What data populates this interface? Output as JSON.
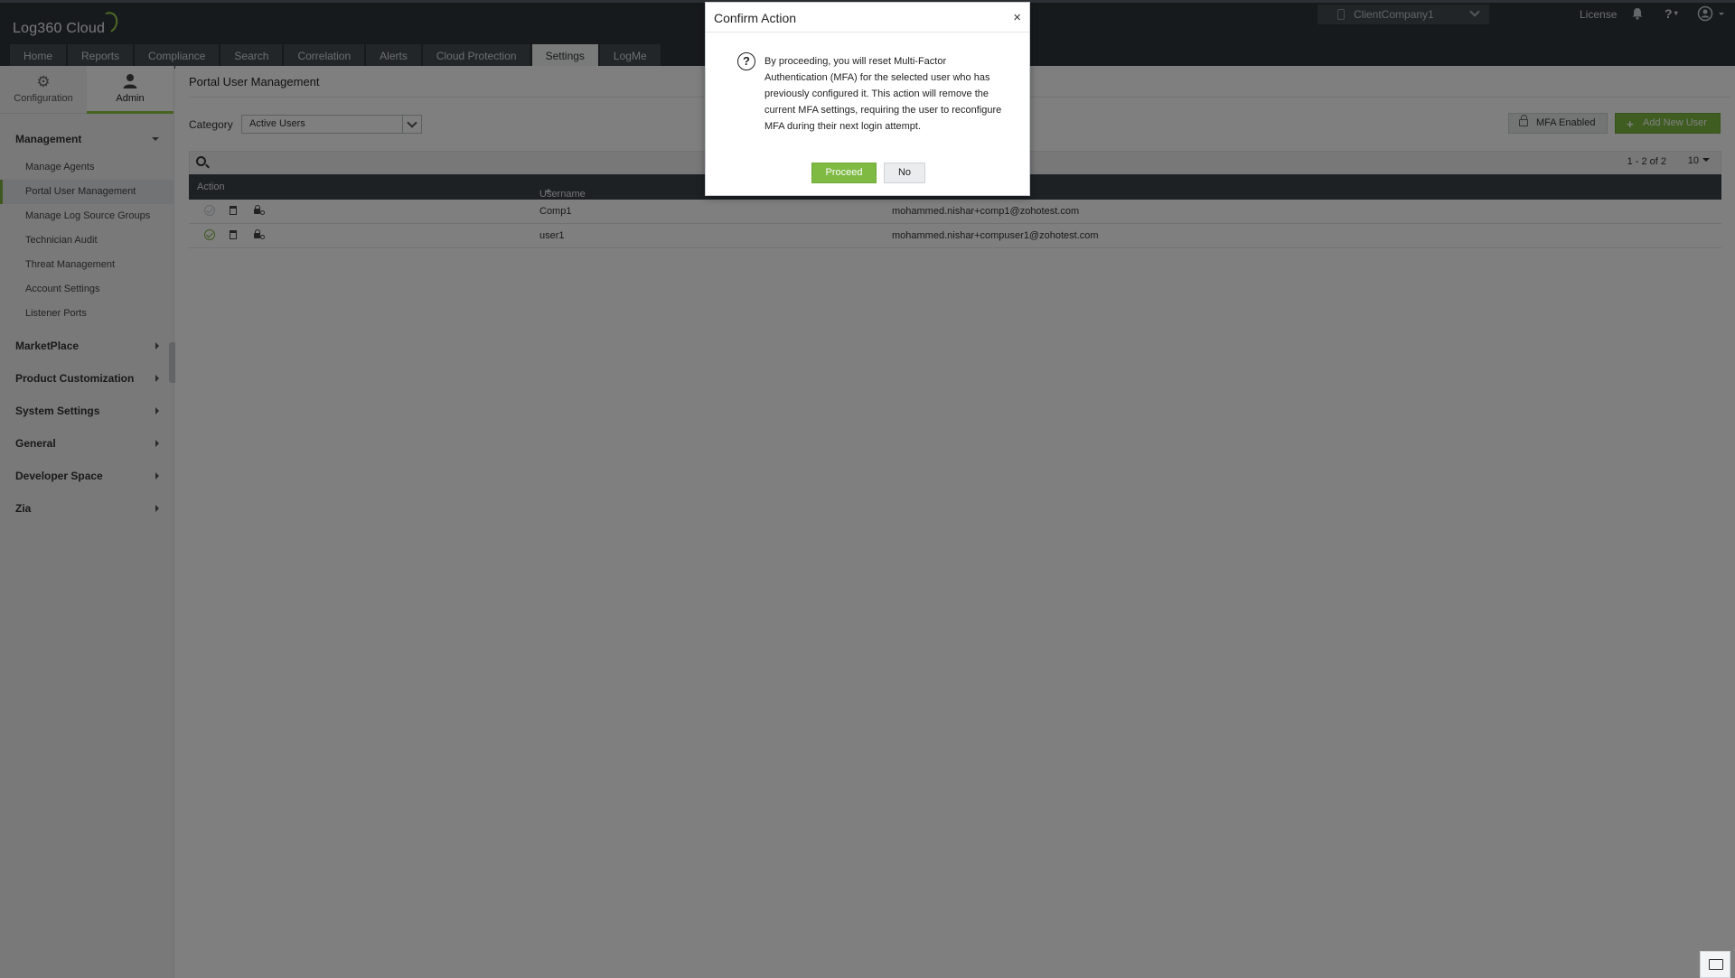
{
  "app": {
    "logo_text": "Log360 Cloud"
  },
  "header": {
    "tabs": [
      {
        "label": "Home"
      },
      {
        "label": "Reports"
      },
      {
        "label": "Compliance"
      },
      {
        "label": "Search"
      },
      {
        "label": "Correlation"
      },
      {
        "label": "Alerts"
      },
      {
        "label": "Cloud Protection"
      },
      {
        "label": "Settings"
      },
      {
        "label": "LogMe"
      }
    ],
    "active_tab": "Settings",
    "client_select": "ClientCompany1",
    "license_link": "License",
    "help_label": "?"
  },
  "sidebar": {
    "switch": {
      "config_label": "Configuration",
      "admin_label": "Admin",
      "active": "Admin"
    },
    "management_label": "Management",
    "management_items": [
      {
        "label": "Manage Agents"
      },
      {
        "label": "Portal User Management"
      },
      {
        "label": "Manage Log Source Groups"
      },
      {
        "label": "Technician Audit"
      },
      {
        "label": "Threat Management"
      },
      {
        "label": "Account Settings"
      },
      {
        "label": "Listener Ports"
      }
    ],
    "active_item": "Portal User Management",
    "sections": [
      {
        "label": "MarketPlace"
      },
      {
        "label": "Product Customization"
      },
      {
        "label": "System Settings"
      },
      {
        "label": "General"
      },
      {
        "label": "Developer Space"
      },
      {
        "label": "Zia"
      }
    ]
  },
  "main": {
    "title": "Portal User Management",
    "category_label": "Category",
    "category_value": "Active Users",
    "mfa_button": "MFA Enabled",
    "add_button": "Add New User",
    "pager_text": "1 - 2 of 2",
    "page_size": "10",
    "columns": [
      "Action",
      "Username"
    ],
    "rows": [
      {
        "username": "Comp1",
        "email": "mohammed.nishar+comp1@zohotest.com",
        "enabled": false
      },
      {
        "username": "user1",
        "email": "mohammed.nishar+compuser1@zohotest.com",
        "enabled": true
      }
    ]
  },
  "modal": {
    "title": "Confirm Action",
    "close_glyph": "×",
    "icon_glyph": "?",
    "message": "By proceeding, you will reset Multi-Factor Authentication (MFA) for the selected user who has previously configured it. This action will remove the current MFA settings, requiring the user to reconfigure MFA during their next login attempt.",
    "proceed_label": "Proceed",
    "no_label": "No"
  },
  "colors": {
    "accent_green": "#7fba43",
    "header_bg": "#2f353b",
    "table_head": "#3b4248"
  }
}
